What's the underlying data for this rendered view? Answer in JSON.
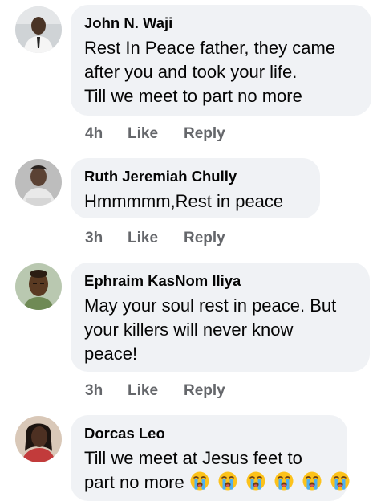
{
  "comments": [
    {
      "author": "John N. Waji",
      "lines": [
        "Rest In Peace father, they came",
        "after you and took your life.",
        "Till we meet to part no more"
      ],
      "time": "4h",
      "like": "Like",
      "reply": "Reply"
    },
    {
      "author": "Ruth Jeremiah Chully",
      "lines": [
        "Hmmmmm,Rest in peace"
      ],
      "time": "3h",
      "like": "Like",
      "reply": "Reply"
    },
    {
      "author": "Ephraim KasNom Iliya",
      "lines": [
        "May your soul rest in peace. But",
        "your killers will never know",
        "peace!"
      ],
      "time": "3h",
      "like": "Like",
      "reply": "Reply"
    },
    {
      "author": "Dorcas Leo",
      "lines": [
        "Till we meet at Jesus feet to",
        "part no more"
      ],
      "emoji": "loudly-crying-face-icon",
      "emoji_count": 6
    }
  ],
  "colors": {
    "bubble": "#f0f2f5",
    "meta": "#65676b",
    "text": "#050505"
  }
}
